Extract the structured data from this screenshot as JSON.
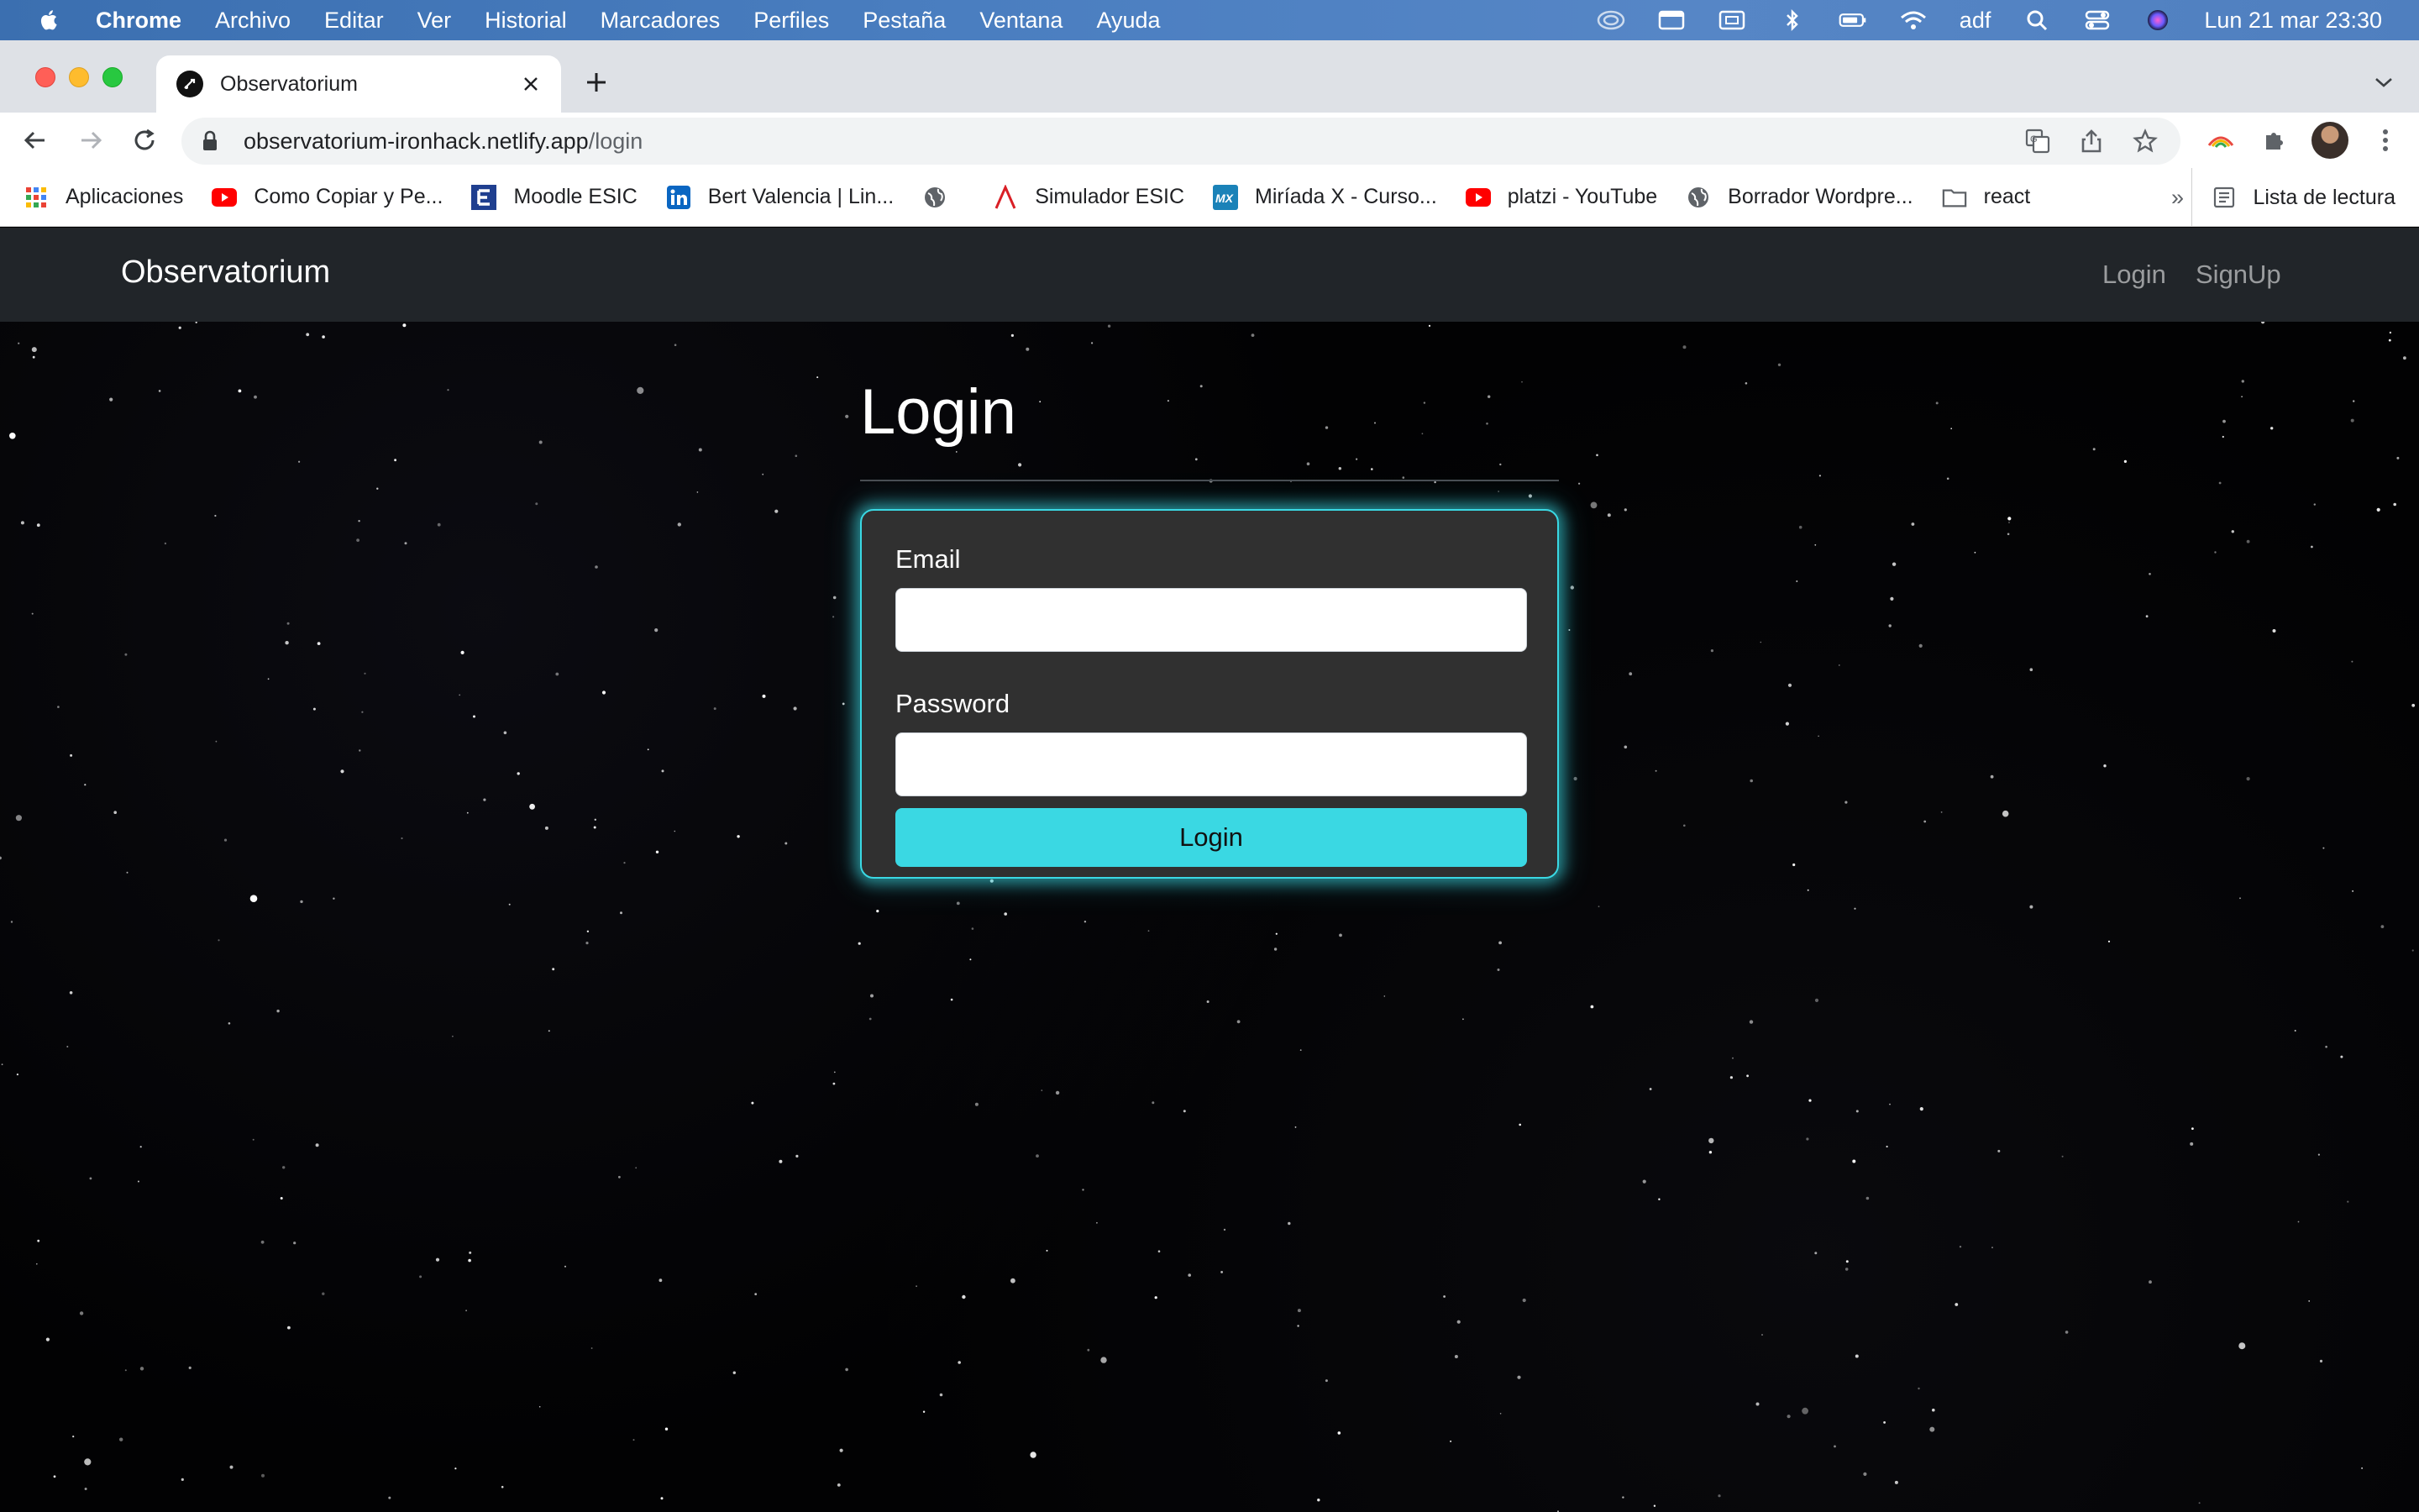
{
  "menubar": {
    "items": [
      "Chrome",
      "Archivo",
      "Editar",
      "Ver",
      "Historial",
      "Marcadores",
      "Perfiles",
      "Pestaña",
      "Ventana",
      "Ayuda"
    ],
    "input_source": "adf",
    "datetime": "Lun 21 mar  23:30"
  },
  "browser": {
    "tab_title": "Observatorium",
    "url_host": "observatorium-ironhack.netlify.app",
    "url_path": "/login"
  },
  "bookmarks": {
    "items": [
      {
        "label": "Aplicaciones",
        "icon": "apps-grid-icon"
      },
      {
        "label": "Como Copiar y Pe...",
        "icon": "youtube-icon"
      },
      {
        "label": "Moodle ESIC",
        "icon": "esic-icon"
      },
      {
        "label": "Bert Valencia | Lin...",
        "icon": "linkedin-icon"
      },
      {
        "label": "",
        "icon": "globe-icon"
      },
      {
        "label": "Simulador ESIC",
        "icon": "simulador-icon"
      },
      {
        "label": "Miríada X - Curso...",
        "icon": "miriada-icon"
      },
      {
        "label": "platzi - YouTube",
        "icon": "youtube-icon"
      },
      {
        "label": "Borrador Wordpre...",
        "icon": "globe-icon"
      },
      {
        "label": "react",
        "icon": "folder-icon"
      }
    ],
    "more": "»",
    "reading_list": "Lista de lectura"
  },
  "site": {
    "brand": "Observatorium",
    "nav": {
      "login": "Login",
      "signup": "SignUp"
    },
    "page_title": "Login",
    "form": {
      "email_label": "Email",
      "email_value": "",
      "password_label": "Password",
      "password_value": "",
      "submit_label": "Login"
    }
  },
  "colors": {
    "accent": "#3ad8e3",
    "navbar": "#212529",
    "card": "#303030"
  }
}
